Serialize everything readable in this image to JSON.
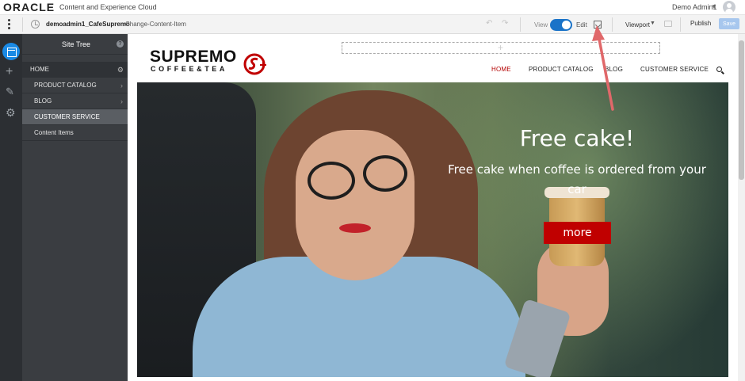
{
  "topbar": {
    "logo": "ORACLE",
    "product": "Content and Experience Cloud",
    "user": "Demo Admin1"
  },
  "toolbar": {
    "site_name": "demoadmin1_CafeSupremo",
    "update_name": "Change-Content-Item",
    "view_label": "View",
    "edit_label": "Edit",
    "mode": "edit",
    "viewport_label": "Viewport",
    "publish_label": "Publish",
    "save_label": "Save"
  },
  "site_tree": {
    "title": "Site Tree",
    "help": "?",
    "home": "HOME",
    "items": [
      {
        "label": "PRODUCT CATALOG",
        "has_children": true
      },
      {
        "label": "BLOG",
        "has_children": true
      },
      {
        "label": "CUSTOMER SERVICE",
        "selected": true
      },
      {
        "label": "Content Items"
      }
    ]
  },
  "page": {
    "brand_name": "SUPREMO",
    "brand_tagline": "COFFEE&TEA",
    "nav": [
      {
        "label": "HOME",
        "active": true
      },
      {
        "label": "PRODUCT CATALOG"
      },
      {
        "label": "BLOG"
      },
      {
        "label": "CUSTOMER SERVICE"
      }
    ],
    "hero": {
      "title": "Free cake!",
      "subtitle": "Free cake when coffee is ordered from your car",
      "button": "more"
    }
  },
  "colors": {
    "accent": "#1a73c8",
    "brand_red": "#c00000",
    "nav_active": "#b30000",
    "rail_bg": "#2c2f33",
    "tree_bg": "#3a3d41",
    "annotation_arrow": "#e0686a"
  },
  "icons": [
    "kebab-menu-icon",
    "clock-icon",
    "undo-icon",
    "redo-icon",
    "layout-icon",
    "chat-icon",
    "pages-icon",
    "plus-icon",
    "brush-icon",
    "gear-icon",
    "search-icon",
    "help-icon",
    "chevron-right-icon"
  ]
}
